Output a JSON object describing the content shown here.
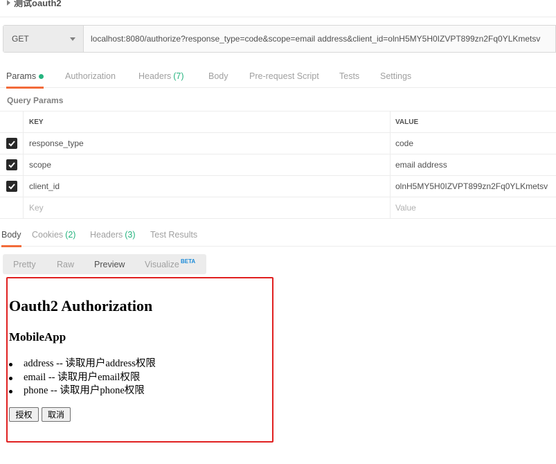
{
  "request": {
    "name": "测试oauth2",
    "method": "GET",
    "url": "localhost:8080/authorize?response_type=code&scope=email address&client_id=olnH5MY5H0IZVPT899zn2Fq0YLKmetsv"
  },
  "request_tabs": [
    {
      "label": "Params",
      "count": "",
      "active": true
    },
    {
      "label": "Authorization",
      "count": ""
    },
    {
      "label": "Headers",
      "count": "(7)"
    },
    {
      "label": "Body",
      "count": ""
    },
    {
      "label": "Pre-request Script",
      "count": ""
    },
    {
      "label": "Tests",
      "count": ""
    },
    {
      "label": "Settings",
      "count": ""
    }
  ],
  "query_params": {
    "section_label": "Query Params",
    "col_key": "KEY",
    "col_value": "VALUE",
    "rows": [
      {
        "key": "response_type",
        "value": "code",
        "checked": true
      },
      {
        "key": "scope",
        "value": "email address",
        "checked": true
      },
      {
        "key": "client_id",
        "value": "olnH5MY5H0IZVPT899zn2Fq0YLKmetsv",
        "checked": true
      }
    ],
    "placeholder_key": "Key",
    "placeholder_value": "Value"
  },
  "response_tabs": [
    {
      "label": "Body",
      "count": "",
      "active": true
    },
    {
      "label": "Cookies",
      "count": "(2)"
    },
    {
      "label": "Headers",
      "count": "(3)"
    },
    {
      "label": "Test Results",
      "count": ""
    }
  ],
  "view_modes": {
    "pretty": "Pretty",
    "raw": "Raw",
    "preview": "Preview",
    "visualize": "Visualize",
    "beta": "BETA",
    "active": "Preview"
  },
  "preview_page": {
    "title": "Oauth2 Authorization",
    "app_name": "MobileApp",
    "scopes": [
      "address -- 读取用户address权限",
      "email -- 读取用户email权限",
      "phone -- 读取用户phone权限"
    ],
    "authorize_label": "授权",
    "cancel_label": "取消"
  },
  "colors": {
    "accent_orange": "#f26b3a",
    "count_green": "#26b47f",
    "beta_blue": "#1a8ad8",
    "highlight_red": "#e02020"
  }
}
